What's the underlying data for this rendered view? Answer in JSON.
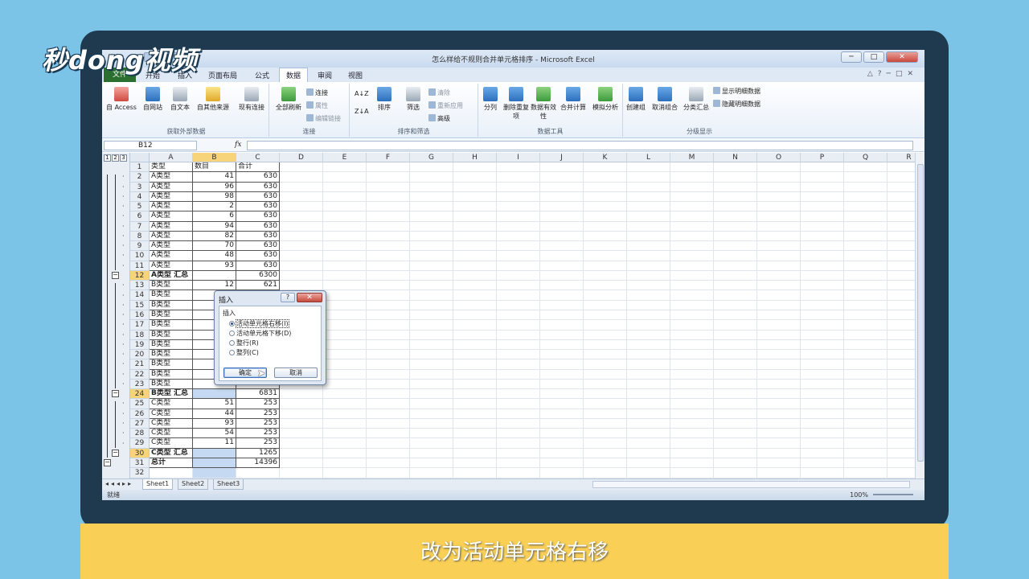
{
  "logo_text": "秒dong视频",
  "caption": "改为活动单元格右移",
  "window": {
    "title": "怎么样给不规则合并单元格排序 - Microsoft Excel",
    "controls": [
      "─",
      "□",
      "✕"
    ]
  },
  "tabs": [
    "文件",
    "开始",
    "插入",
    "页面布局",
    "公式",
    "数据",
    "审阅",
    "视图"
  ],
  "active_tab": "数据",
  "ribbon": {
    "get_external": {
      "label": "获取外部数据",
      "buttons": [
        "自 Access",
        "自网站",
        "自文本",
        "自其他来源",
        "现有连接"
      ]
    },
    "connections": {
      "label": "连接",
      "big": "全部刷新",
      "small": [
        "连接",
        "属性",
        "编辑链接"
      ]
    },
    "sort_filter": {
      "label": "排序和筛选",
      "sort": "排序",
      "filter": "筛选",
      "small": [
        "清除",
        "重新应用",
        "高级"
      ]
    },
    "data_tools": {
      "label": "数据工具",
      "buttons": [
        "分列",
        "删除重复项",
        "数据有效性",
        "合并计算",
        "模拟分析"
      ]
    },
    "outline": {
      "label": "分级显示",
      "buttons": [
        "创建组",
        "取消组合",
        "分类汇总"
      ],
      "small": [
        "显示明细数据",
        "隐藏明细数据"
      ]
    }
  },
  "formula_bar": {
    "name_box": "B12",
    "fx": "fx",
    "formula": ""
  },
  "outline_levels": [
    "1",
    "2",
    "3"
  ],
  "columns": [
    "A",
    "B",
    "C",
    "D",
    "E",
    "F",
    "G",
    "H",
    "I",
    "J",
    "K",
    "L",
    "M",
    "N",
    "O",
    "P",
    "Q",
    "R"
  ],
  "rows": [
    {
      "n": "1",
      "a": "类型",
      "b": "数目",
      "c": "合计"
    },
    {
      "n": "2",
      "a": "A类型",
      "b": "41",
      "c": "630"
    },
    {
      "n": "3",
      "a": "A类型",
      "b": "96",
      "c": "630"
    },
    {
      "n": "4",
      "a": "A类型",
      "b": "98",
      "c": "630"
    },
    {
      "n": "5",
      "a": "A类型",
      "b": "2",
      "c": "630"
    },
    {
      "n": "6",
      "a": "A类型",
      "b": "6",
      "c": "630"
    },
    {
      "n": "7",
      "a": "A类型",
      "b": "94",
      "c": "630"
    },
    {
      "n": "8",
      "a": "A类型",
      "b": "82",
      "c": "630"
    },
    {
      "n": "9",
      "a": "A类型",
      "b": "70",
      "c": "630"
    },
    {
      "n": "10",
      "a": "A类型",
      "b": "48",
      "c": "630"
    },
    {
      "n": "11",
      "a": "A类型",
      "b": "93",
      "c": "630"
    },
    {
      "n": "12",
      "a": "A类型 汇总",
      "b": "",
      "c": "6300"
    },
    {
      "n": "13",
      "a": "B类型",
      "b": "12",
      "c": "621"
    },
    {
      "n": "14",
      "a": "B类型",
      "b": "",
      "c": ""
    },
    {
      "n": "15",
      "a": "B类型",
      "b": "",
      "c": ""
    },
    {
      "n": "16",
      "a": "B类型",
      "b": "",
      "c": ""
    },
    {
      "n": "17",
      "a": "B类型",
      "b": "",
      "c": ""
    },
    {
      "n": "18",
      "a": "B类型",
      "b": "",
      "c": ""
    },
    {
      "n": "19",
      "a": "B类型",
      "b": "",
      "c": ""
    },
    {
      "n": "20",
      "a": "B类型",
      "b": "",
      "c": ""
    },
    {
      "n": "21",
      "a": "B类型",
      "b": "",
      "c": ""
    },
    {
      "n": "22",
      "a": "B类型",
      "b": "",
      "c": ""
    },
    {
      "n": "23",
      "a": "B类型",
      "b": "",
      "c": ""
    },
    {
      "n": "24",
      "a": "B类型 汇总",
      "b": "",
      "c": "6831"
    },
    {
      "n": "25",
      "a": "C类型",
      "b": "51",
      "c": "253"
    },
    {
      "n": "26",
      "a": "C类型",
      "b": "44",
      "c": "253"
    },
    {
      "n": "27",
      "a": "C类型",
      "b": "93",
      "c": "253"
    },
    {
      "n": "28",
      "a": "C类型",
      "b": "54",
      "c": "253"
    },
    {
      "n": "29",
      "a": "C类型",
      "b": "11",
      "c": "253"
    },
    {
      "n": "30",
      "a": "C类型 汇总",
      "b": "",
      "c": "1265"
    },
    {
      "n": "31",
      "a": "总计",
      "b": "",
      "c": "14396"
    },
    {
      "n": "32",
      "a": "",
      "b": "",
      "c": ""
    }
  ],
  "sheets": [
    "Sheet1",
    "Sheet2",
    "Sheet3"
  ],
  "status": {
    "ready": "就绪",
    "zoom": "100%"
  },
  "dialog": {
    "title": "插入",
    "section": "插入",
    "options": [
      "活动单元格右移(I)",
      "活动单元格下移(D)",
      "整行(R)",
      "整列(C)"
    ],
    "selected_index": 0,
    "ok": "确定",
    "cancel": "取消"
  }
}
